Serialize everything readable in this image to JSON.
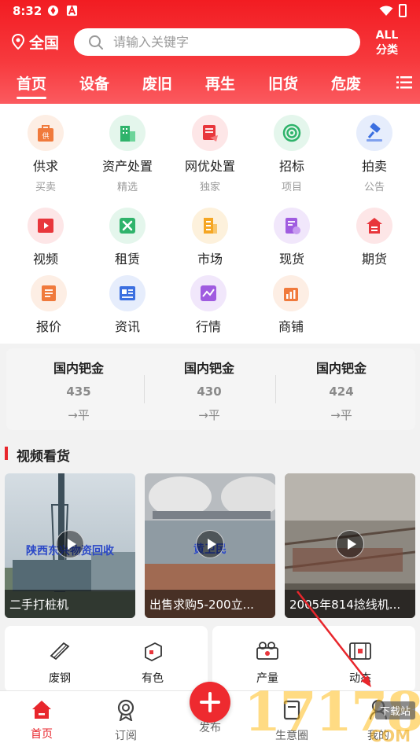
{
  "status_bar": {
    "time": "8:32"
  },
  "header": {
    "location": "全国",
    "search_placeholder": "请输入关键字",
    "all_categories": {
      "line1": "ALL",
      "line2": "分类"
    }
  },
  "tabs": [
    {
      "label": "首页",
      "active": true
    },
    {
      "label": "设备"
    },
    {
      "label": "废旧"
    },
    {
      "label": "再生"
    },
    {
      "label": "旧货"
    },
    {
      "label": "危废"
    }
  ],
  "grid": {
    "row1": [
      {
        "label": "供求",
        "sub": "买卖",
        "icon": "supply-demand-icon",
        "color": "#f07a3c"
      },
      {
        "label": "资产处置",
        "sub": "精选",
        "icon": "asset-disposal-icon",
        "color": "#2fb36b"
      },
      {
        "label": "网优处置",
        "sub": "独家",
        "icon": "online-disposal-icon",
        "color": "#e8363c"
      },
      {
        "label": "招标",
        "sub": "项目",
        "icon": "tender-icon",
        "color": "#2fb36b"
      },
      {
        "label": "拍卖",
        "sub": "公告",
        "icon": "auction-icon",
        "color": "#3b6fe0"
      }
    ],
    "row2": [
      {
        "label": "视频",
        "icon": "video-icon",
        "color": "#e8363c"
      },
      {
        "label": "租赁",
        "icon": "lease-icon",
        "color": "#2fb36b"
      },
      {
        "label": "市场",
        "icon": "market-icon",
        "color": "#f5a623"
      },
      {
        "label": "现货",
        "icon": "spot-goods-icon",
        "color": "#a05ce0"
      },
      {
        "label": "期货",
        "icon": "futures-icon",
        "color": "#e8363c"
      }
    ],
    "row3": [
      {
        "label": "报价",
        "icon": "quote-icon",
        "color": "#f07a3c"
      },
      {
        "label": "资讯",
        "icon": "news-icon",
        "color": "#3b6fe0"
      },
      {
        "label": "行情",
        "icon": "market-trend-icon",
        "color": "#a05ce0"
      },
      {
        "label": "商铺",
        "icon": "shop-icon",
        "color": "#f07a3c"
      }
    ]
  },
  "prices": [
    {
      "name": "国内钯金",
      "value": "435",
      "trend": "→平"
    },
    {
      "name": "国内钯金",
      "value": "430",
      "trend": "→平"
    },
    {
      "name": "国内钯金",
      "value": "424",
      "trend": "→平"
    }
  ],
  "video_section": {
    "title": "视频看货",
    "videos": [
      {
        "caption": "二手打桩机",
        "overlay": "陕西东兴物资回收"
      },
      {
        "caption": "出售求购5-200立...",
        "overlay": "黄卫民"
      },
      {
        "caption": "2005年814捻线机..."
      }
    ]
  },
  "cards": [
    {
      "items": [
        {
          "label": "废钢",
          "icon": "scrap-steel-icon"
        },
        {
          "label": "有色",
          "icon": "nonferrous-icon"
        }
      ]
    },
    {
      "items": [
        {
          "label": "产量",
          "icon": "output-icon"
        },
        {
          "label": "动态",
          "icon": "dynamics-icon"
        }
      ]
    }
  ],
  "bottom_nav": [
    {
      "label": "首页",
      "icon": "home-icon",
      "active": true
    },
    {
      "label": "订阅",
      "icon": "subscribe-icon"
    },
    {
      "label": "发布",
      "icon": "publish-icon"
    },
    {
      "label": "生意圈",
      "icon": "business-circle-icon"
    },
    {
      "label": "我的",
      "icon": "profile-icon"
    }
  ],
  "watermark": {
    "digits": "17178",
    "badge": "下载站",
    "suffix": "COM"
  },
  "colors": {
    "brand_red": "#f21c22",
    "accent": "#e8262c"
  }
}
